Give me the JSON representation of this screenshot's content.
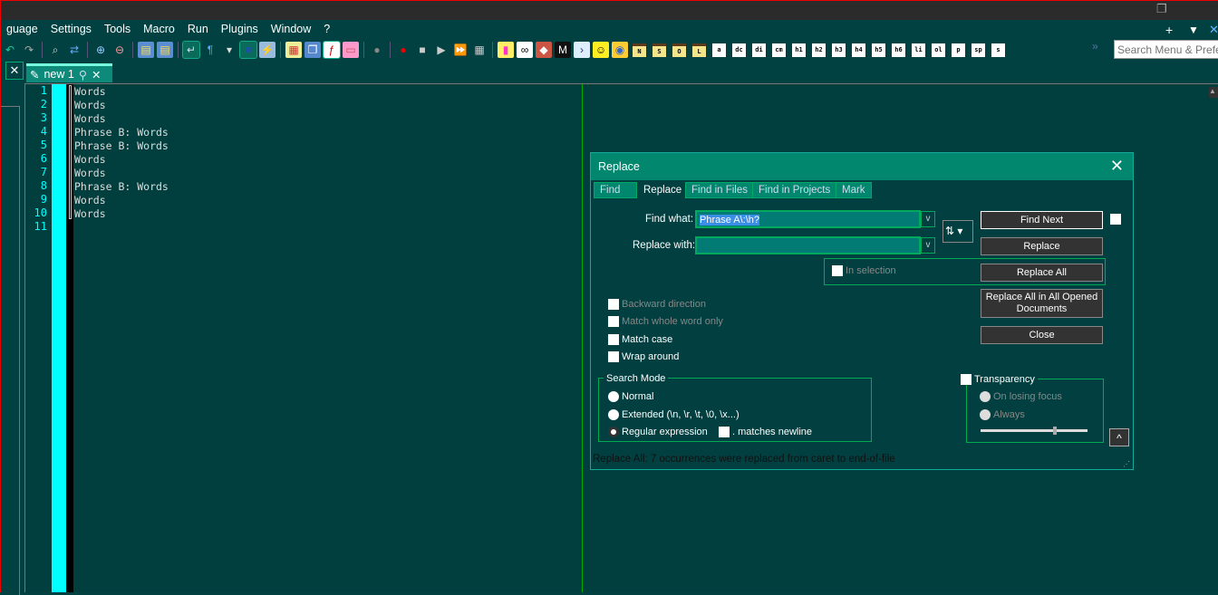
{
  "menu": [
    "guage",
    "Settings",
    "Tools",
    "Macro",
    "Run",
    "Plugins",
    "Window",
    "?"
  ],
  "window_controls": {
    "restore": "❐",
    "plus": "+",
    "dropdown": "▼",
    "close": "✕"
  },
  "toolbar": {
    "icons": [
      "undo-icon",
      "redo-icon",
      "find-icon",
      "replace-icon",
      "zoom-in-icon",
      "zoom-out-icon",
      "sync-vertical-icon",
      "sync-horizontal-icon",
      "word-wrap-icon",
      "show-all-chars-icon",
      "dropdown-icon",
      "indent-guide-icon",
      "user-defined-language-icon",
      "document-map-icon",
      "document-list-icon",
      "function-list-icon",
      "folder-workspace-icon",
      "monitoring-icon",
      "record-macro-icon",
      "stop-macro-icon",
      "play-macro-icon",
      "run-macro-multiple-icon",
      "save-macro-icon",
      "plugin-icon",
      "chain-icon",
      "git-icon",
      "markdown-icon",
      "console-icon",
      "smiley-icon",
      "spell-check-icon"
    ],
    "tag_buttons": [
      "N",
      "S",
      "O",
      "L",
      "a",
      "dc",
      "di",
      "cm",
      "h1",
      "h2",
      "h3",
      "h4",
      "h5",
      "h6",
      "li",
      "ol",
      "p",
      "sp",
      "s"
    ],
    "overflow": "»"
  },
  "search": {
    "placeholder": "Search Menu & Preferences"
  },
  "tabs": [
    {
      "label": "new 1"
    }
  ],
  "editor": {
    "lines": [
      "Words",
      "Words",
      "Words",
      "Phrase B: Words",
      "Phrase B: Words",
      "Words",
      "Words",
      "Phrase B: Words",
      "Words",
      "Words",
      ""
    ]
  },
  "dialog": {
    "title": "Replace",
    "tabs": [
      "Find",
      "Replace",
      "Find in Files",
      "Find in Projects",
      "Mark"
    ],
    "active_tab": "Replace",
    "find_label": "Find what:",
    "find_value": "Phrase A\\:\\h?",
    "replace_label": "Replace with:",
    "replace_value": "",
    "in_selection": "In selection",
    "buttons": {
      "find_next": "Find Next",
      "replace": "Replace",
      "replace_all": "Replace All",
      "replace_all_opened": "Replace All in All Opened Documents",
      "close": "Close"
    },
    "options": [
      {
        "label": "Backward direction",
        "checked": false,
        "disabled": true
      },
      {
        "label": "Match whole word only",
        "checked": false,
        "disabled": true
      },
      {
        "label": "Match case",
        "checked": false,
        "disabled": false
      },
      {
        "label": "Wrap around",
        "checked": false,
        "disabled": false
      }
    ],
    "search_mode": {
      "title": "Search Mode",
      "options": [
        "Normal",
        "Extended (\\n, \\r, \\t, \\0, \\x...)",
        "Regular expression"
      ],
      "selected": "Regular expression",
      "matches_newline": ". matches newline"
    },
    "transparency": {
      "title": "Transparency",
      "options": [
        "On losing focus",
        "Always"
      ],
      "slider_fraction": 0.7
    },
    "status": "Replace All: 7 occurrences were replaced from caret to end-of-file",
    "collapse": "^"
  }
}
